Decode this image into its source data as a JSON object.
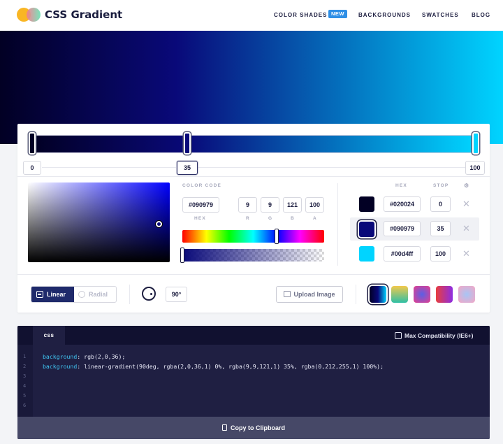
{
  "header": {
    "brand": "CSS Gradient",
    "nav": [
      {
        "label": "COLOR SHADES",
        "badge": "NEW"
      },
      {
        "label": "BACKGROUNDS"
      },
      {
        "label": "SWATCHES"
      },
      {
        "label": "BLOG"
      }
    ]
  },
  "gradient_stops": [
    {
      "position": "0",
      "hex": "#020024",
      "stop": "0"
    },
    {
      "position": "35",
      "hex": "#090979",
      "stop": "35"
    },
    {
      "position": "100",
      "hex": "#00d4ff",
      "stop": "100"
    }
  ],
  "picker": {
    "color_code_label": "COLOR CODE",
    "hex_value": "#090979",
    "hex_label": "HEX",
    "r": "9",
    "g": "9",
    "b": "121",
    "a": "100",
    "r_label": "R",
    "g_label": "G",
    "b_label": "B",
    "a_label": "A"
  },
  "stops_table": {
    "hex_header": "HEX",
    "stop_header": "STOP"
  },
  "controls": {
    "linear": "Linear",
    "radial": "Radial",
    "angle": "90°",
    "upload": "Upload Image"
  },
  "presets": [
    {
      "colors": [
        "#020024",
        "#090979",
        "#00d4ff"
      ]
    },
    {
      "colors": [
        "#f2c94c",
        "#2fbfa5"
      ]
    },
    {
      "colors": [
        "#e83e8c",
        "#5a5fe6"
      ]
    },
    {
      "colors": [
        "#e83e3e",
        "#8e2de2"
      ]
    },
    {
      "colors": [
        "#f5a7c5",
        "#a7c5f5"
      ]
    }
  ],
  "code": {
    "tab": "css",
    "compat": "Max Compatibility (IE6+)",
    "line_numbers": [
      "1",
      "2",
      "3",
      "4",
      "5",
      "6"
    ],
    "line1_prop": "background",
    "line1_val": ": rgb(2,0,36);",
    "line2_prop": "background",
    "line2_val": ": linear-gradient(90deg, rgba(2,0,36,1) 0%, rgba(9,9,121,1) 35%, rgba(0,212,255,1) 100%);",
    "copy": "Copy to Clipboard"
  },
  "colors": {
    "accent": "#1f2a6b",
    "badge": "#2f8fe6",
    "code_bg": "#1f1f42",
    "code_prop": "#40c5f2"
  },
  "icons": [
    "logo-icon",
    "radial-icon",
    "angle-dial-icon",
    "image-icon",
    "copy-icon",
    "close-icon",
    "settings-icon"
  ]
}
